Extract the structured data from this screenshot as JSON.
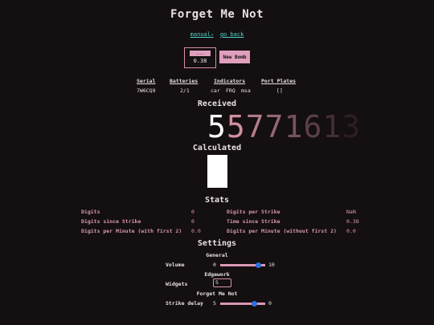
{
  "page": {
    "title": "Forget Me Not"
  },
  "links": {
    "manual": "manual",
    "manual_icon": "external-link-icon",
    "go_back": "go back"
  },
  "timer": {
    "button_label": "...",
    "value": "0.38"
  },
  "new_bomb_label": "New Bomb",
  "bomb_info": {
    "serial_header": "Serial",
    "serial": "7W6CQ9",
    "batteries_header": "Batteries",
    "batteries": "2/1",
    "indicators_header": "Indicators",
    "indicators": [
      "car",
      "FRQ",
      "msa"
    ],
    "ports_header": "Port Plates",
    "ports": "[]"
  },
  "received": {
    "heading": "Received",
    "digits": [
      "5",
      "5",
      "7",
      "7",
      "1",
      "6",
      "1",
      "3"
    ]
  },
  "calculated": {
    "heading": "Calculated"
  },
  "stats": {
    "heading": "Stats",
    "left": [
      {
        "label": "Digits",
        "value": "0"
      },
      {
        "label": "Digits since Strike",
        "value": "0"
      },
      {
        "label": "Digits per Minute (with first 2)",
        "value": "0.0"
      }
    ],
    "right": [
      {
        "label": "Digits per Strike",
        "value": "NaN"
      },
      {
        "label": "Time since Strike",
        "value": "0.38"
      },
      {
        "label": "Digits per Minute (without first 2)",
        "value": "0.0"
      }
    ]
  },
  "settings": {
    "heading": "Settings",
    "general_heading": "General",
    "volume_label": "Volume",
    "volume_min": "0",
    "volume_max": "10",
    "volume_level": 0.85,
    "edgework_heading": "Edgework",
    "widgets_label": "Widgets",
    "widgets_value": "5",
    "fmn_heading": "Forget Me Not",
    "strike_delay_label": "Strike delay",
    "strike_delay_min": "5",
    "strike_delay_max": "0",
    "strike_delay_level": 0.75
  },
  "colors": {
    "background": "#140f10",
    "accent": "#e0a0bd",
    "link": "#4dd6c8",
    "thumb": "#2f6fe0"
  }
}
